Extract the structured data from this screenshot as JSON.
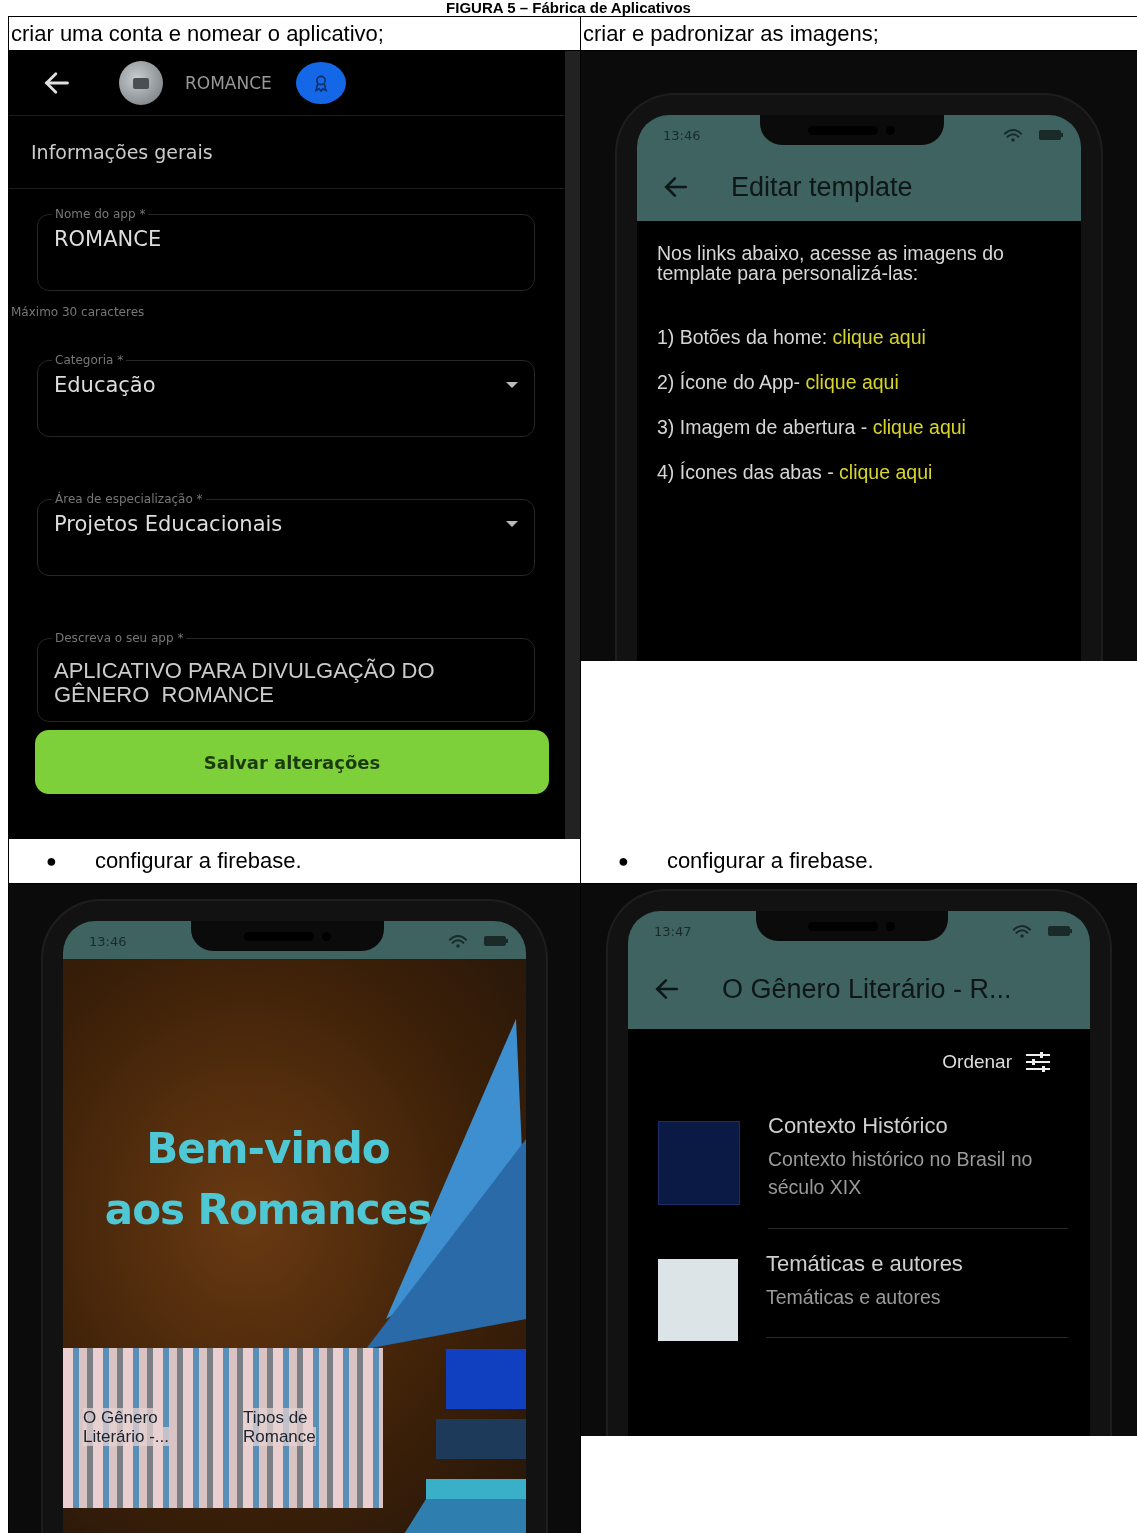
{
  "figure_title": "FIGURA 5 – Fábrica de Aplicativos",
  "cells": [
    {
      "kind": "form",
      "caption": "criar uma conta e nomear o aplicativo;",
      "app_name": "ROMANCE",
      "section": "Informações gerais",
      "fields": [
        {
          "kind": "text",
          "label": "Nome do app *",
          "value": "ROMANCE",
          "helper": "Máximo 30 caracteres"
        },
        {
          "kind": "select",
          "label": "Categoria *",
          "value": "Educação"
        },
        {
          "kind": "select",
          "label": "Área de especialização *",
          "value": "Projetos Educacionais"
        },
        {
          "kind": "textarea",
          "label": "Descreva o seu app *",
          "value": "APLICATIVO PARA DIVULGAÇÃO DO GÊNERO  ROMANCE"
        }
      ],
      "save_button": "Salvar alterações"
    },
    {
      "kind": "template",
      "caption": "criar e padronizar as imagens;",
      "time": "13:46",
      "app_bar_title": "Editar template",
      "intro": "Nos links abaixo, acesse as imagens do template para personalizá-las:",
      "links": [
        {
          "text": "1) Botões da home: ",
          "link": "clique aqui"
        },
        {
          "text": "2) Ícone do App- ",
          "link": "clique aqui"
        },
        {
          "text": "3) Imagem de abertura - ",
          "link": "clique aqui"
        },
        {
          "text": "4) Ícones das abas - ",
          "link": "clique aqui"
        }
      ]
    },
    {
      "kind": "home",
      "bullet": "●",
      "caption": "configurar a firebase.",
      "time": "13:46",
      "welcome": "Bem-vindo aos Romances",
      "tiles": [
        "O Gênero Literário -...",
        "Tipos de Romance"
      ]
    },
    {
      "kind": "list",
      "bullet": "●",
      "caption": "configurar a firebase.",
      "time": "13:47",
      "app_bar_title": "O Gênero Literário - R...",
      "sort_label": "Ordenar",
      "items": [
        {
          "title": "Contexto Histórico",
          "subtitle": "Contexto histórico no Brasil no século XIX"
        },
        {
          "title": "Temáticas e autores",
          "subtitle": "Temáticas e autores"
        }
      ]
    }
  ]
}
